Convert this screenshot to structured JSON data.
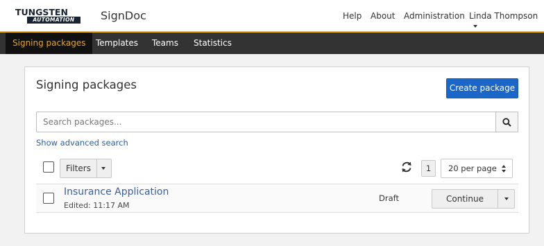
{
  "brand": {
    "logo_line1": "TUNGSTEN",
    "logo_line2": "AUTOMATION",
    "app_name": "SignDoc",
    "accent_color": "#f0b400"
  },
  "topnav": {
    "help": "Help",
    "about": "About",
    "administration": "Administration",
    "user": "Linda Thompson"
  },
  "navbar": {
    "tabs": [
      {
        "label": "Signing packages",
        "active": true
      },
      {
        "label": "Templates",
        "active": false
      },
      {
        "label": "Teams",
        "active": false
      },
      {
        "label": "Statistics",
        "active": false
      }
    ]
  },
  "panel": {
    "title": "Signing packages",
    "create_button": "Create package",
    "search_placeholder": "Search packages...",
    "advanced_search": "Show advanced search",
    "filters_label": "Filters",
    "page_number": "1",
    "per_page": "20 per page"
  },
  "packages": [
    {
      "title": "Insurance Application",
      "edited": "Edited: 11:17 AM",
      "status": "Draft",
      "action": "Continue"
    }
  ],
  "icons": {
    "search": "search-icon",
    "refresh": "refresh-icon",
    "caret": "chevron-down-icon"
  }
}
